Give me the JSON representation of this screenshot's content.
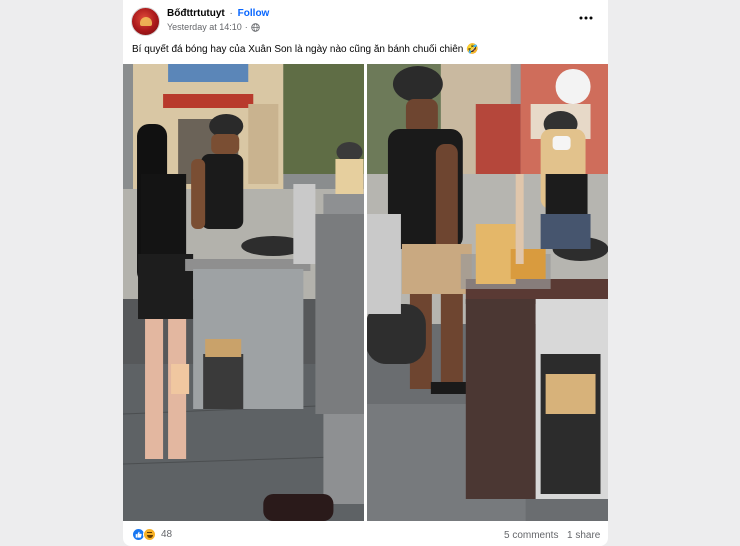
{
  "post": {
    "author": "Bốđttrtutuyt",
    "separator": "·",
    "follow_label": "Follow",
    "timestamp": "Yesterday at 14:10",
    "timestamp_separator": "·",
    "privacy_icon": "globe-icon",
    "menu_icon": "more-options-icon",
    "caption": "Bí quyết đá bóng hay của Xuân Son là ngày nào cũng ăn bánh chuối chiên 🤣"
  },
  "media": {
    "left_image": "photo-street-food-cart-left",
    "right_image": "photo-street-food-cart-right"
  },
  "footer": {
    "reaction_icons": [
      "like-icon",
      "haha-icon"
    ],
    "reaction_count": "48",
    "comments": "5 comments",
    "shares": "1 share"
  },
  "colors": {
    "accent": "#0866ff",
    "secondary_text": "#65676b",
    "background": "#ededee"
  }
}
